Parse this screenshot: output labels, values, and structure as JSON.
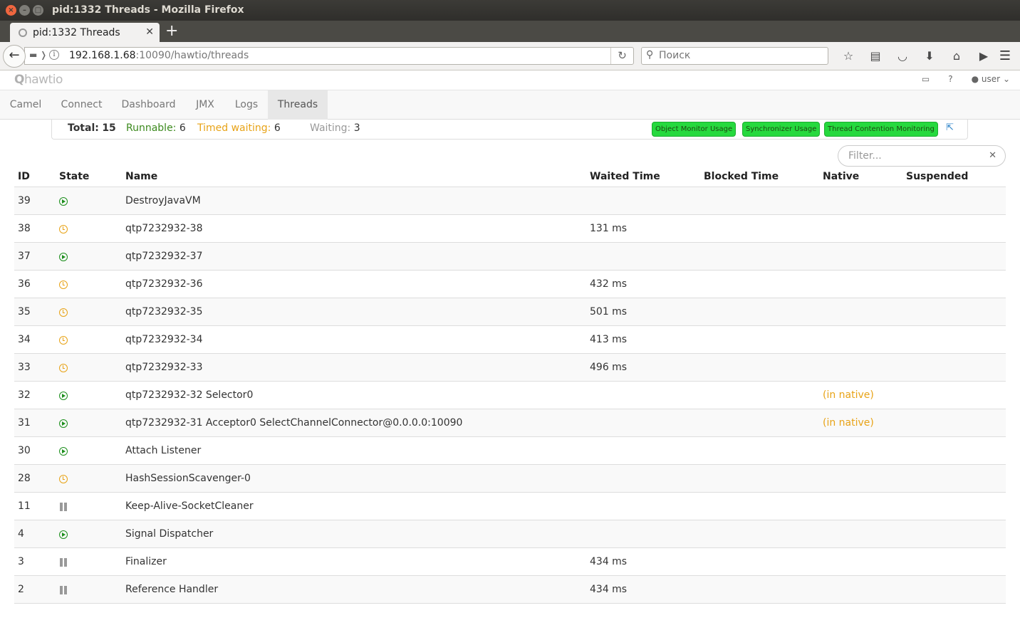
{
  "window": {
    "title": "pid:1332 Threads - Mozilla Firefox"
  },
  "browser": {
    "tab_title": "pid:1332 Threads",
    "new_tab_label": "+",
    "url_host": "192.168.1.68",
    "url_rest": ":10090/hawtio/threads",
    "search_placeholder": "Поиск"
  },
  "app": {
    "logo_mark": "Q",
    "logo_text": "hawtio",
    "user_label": "user"
  },
  "nav": {
    "items": [
      "Camel",
      "Connect",
      "Dashboard",
      "JMX",
      "Logs",
      "Threads"
    ],
    "active": "Threads"
  },
  "summary": {
    "total_label": "Total:",
    "total_value": "15",
    "runnable_label": "Runnable:",
    "runnable_value": "6",
    "timed_label": "Timed waiting:",
    "timed_value": "6",
    "waiting_label": "Waiting:",
    "waiting_value": "3",
    "badges": [
      "Object Monitor Usage",
      "Synchronizer Usage",
      "Thread Contention Monitoring"
    ]
  },
  "filter": {
    "placeholder": "Filter..."
  },
  "table": {
    "headers": {
      "id": "ID",
      "state": "State",
      "name": "Name",
      "waited": "Waited Time",
      "blocked": "Blocked Time",
      "native": "Native",
      "suspended": "Suspended"
    },
    "rows": [
      {
        "id": "39",
        "state": "runnable",
        "name": "DestroyJavaVM",
        "waited": "",
        "native": ""
      },
      {
        "id": "38",
        "state": "timed",
        "name": "qtp7232932-38",
        "waited": "131 ms",
        "native": ""
      },
      {
        "id": "37",
        "state": "runnable",
        "name": "qtp7232932-37",
        "waited": "",
        "native": ""
      },
      {
        "id": "36",
        "state": "timed",
        "name": "qtp7232932-36",
        "waited": "432 ms",
        "native": ""
      },
      {
        "id": "35",
        "state": "timed",
        "name": "qtp7232932-35",
        "waited": "501 ms",
        "native": ""
      },
      {
        "id": "34",
        "state": "timed",
        "name": "qtp7232932-34",
        "waited": "413 ms",
        "native": ""
      },
      {
        "id": "33",
        "state": "timed",
        "name": "qtp7232932-33",
        "waited": "496 ms",
        "native": ""
      },
      {
        "id": "32",
        "state": "runnable",
        "name": "qtp7232932-32 Selector0",
        "waited": "",
        "native": "(in native)"
      },
      {
        "id": "31",
        "state": "runnable",
        "name": "qtp7232932-31 Acceptor0 SelectChannelConnector@0.0.0.0:10090",
        "waited": "",
        "native": "(in native)"
      },
      {
        "id": "30",
        "state": "runnable",
        "name": "Attach Listener",
        "waited": "",
        "native": ""
      },
      {
        "id": "28",
        "state": "timed",
        "name": "HashSessionScavenger-0",
        "waited": "",
        "native": ""
      },
      {
        "id": "11",
        "state": "waiting",
        "name": "Keep-Alive-SocketCleaner",
        "waited": "",
        "native": ""
      },
      {
        "id": "4",
        "state": "runnable",
        "name": "Signal Dispatcher",
        "waited": "",
        "native": ""
      },
      {
        "id": "3",
        "state": "waiting",
        "name": "Finalizer",
        "waited": "434 ms",
        "native": ""
      },
      {
        "id": "2",
        "state": "waiting",
        "name": "Reference Handler",
        "waited": "434 ms",
        "native": ""
      }
    ]
  },
  "colors": {
    "runnable": "#3c8a1e",
    "timed_waiting": "#e8a317",
    "waiting": "#999999",
    "badge": "#26d93e"
  }
}
